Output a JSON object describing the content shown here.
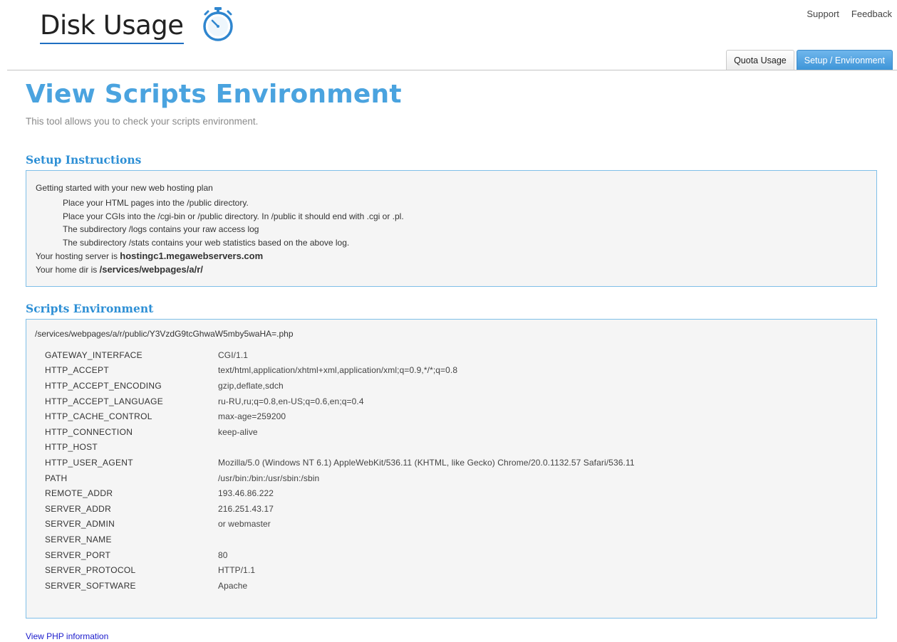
{
  "app": {
    "logo_text": "Disk Usage",
    "logo_icon": "stopwatch-icon",
    "accent_color": "#4aa3df",
    "link_color": "#1a1acc"
  },
  "top_links": {
    "support": "Support",
    "feedback": "Feedback"
  },
  "tabs": [
    {
      "label": "Quota Usage",
      "active": false
    },
    {
      "label": "Setup / Environment",
      "active": true
    }
  ],
  "page": {
    "title": "View Scripts Environment",
    "subtitle": "This tool allows you to check your scripts environment."
  },
  "setup": {
    "title": "Setup Instructions",
    "lead": "Getting started with your new web hosting plan",
    "items": [
      "Place your HTML pages into the /public directory.",
      "Place your CGIs into the /cgi-bin or /public directory. In /public it should end with .cgi or .pl.",
      "The subdirectory /logs contains your raw access log",
      "The subdirectory /stats contains your web statistics based on the above log."
    ],
    "server_prefix": "Your hosting server is ",
    "server_value": "hostingc1.megawebservers.com",
    "homedir_prefix": "Your home dir is ",
    "homedir_value": "/services/webpages/a/r/"
  },
  "scripts": {
    "title": "Scripts Environment",
    "path": "/services/webpages/a/r/public/Y3VzdG9tcGhwaW5mby5waHA=.php",
    "env": [
      {
        "key": "GATEWAY_INTERFACE",
        "value": "CGI/1.1"
      },
      {
        "key": "HTTP_ACCEPT",
        "value": "text/html,application/xhtml+xml,application/xml;q=0.9,*/*;q=0.8"
      },
      {
        "key": "HTTP_ACCEPT_ENCODING",
        "value": "gzip,deflate,sdch"
      },
      {
        "key": "HTTP_ACCEPT_LANGUAGE",
        "value": "ru-RU,ru;q=0.8,en-US;q=0.6,en;q=0.4"
      },
      {
        "key": "HTTP_CACHE_CONTROL",
        "value": "max-age=259200"
      },
      {
        "key": "HTTP_CONNECTION",
        "value": "keep-alive"
      },
      {
        "key": "HTTP_HOST",
        "value": ""
      },
      {
        "key": "HTTP_USER_AGENT",
        "value": "Mozilla/5.0 (Windows NT 6.1) AppleWebKit/536.11 (KHTML, like Gecko) Chrome/20.0.1132.57 Safari/536.11"
      },
      {
        "key": "PATH",
        "value": "/usr/bin:/bin:/usr/sbin:/sbin"
      },
      {
        "key": "REMOTE_ADDR",
        "value": "193.46.86.222"
      },
      {
        "key": "SERVER_ADDR",
        "value": "216.251.43.17"
      },
      {
        "key": "SERVER_ADMIN",
        "value": "or webmaster"
      },
      {
        "key": "SERVER_NAME",
        "value": ""
      },
      {
        "key": "SERVER_PORT",
        "value": "80"
      },
      {
        "key": "SERVER_PROTOCOL",
        "value": "HTTP/1.1"
      },
      {
        "key": "SERVER_SOFTWARE",
        "value": "Apache"
      }
    ]
  },
  "footer": {
    "php_link": "View PHP information"
  }
}
